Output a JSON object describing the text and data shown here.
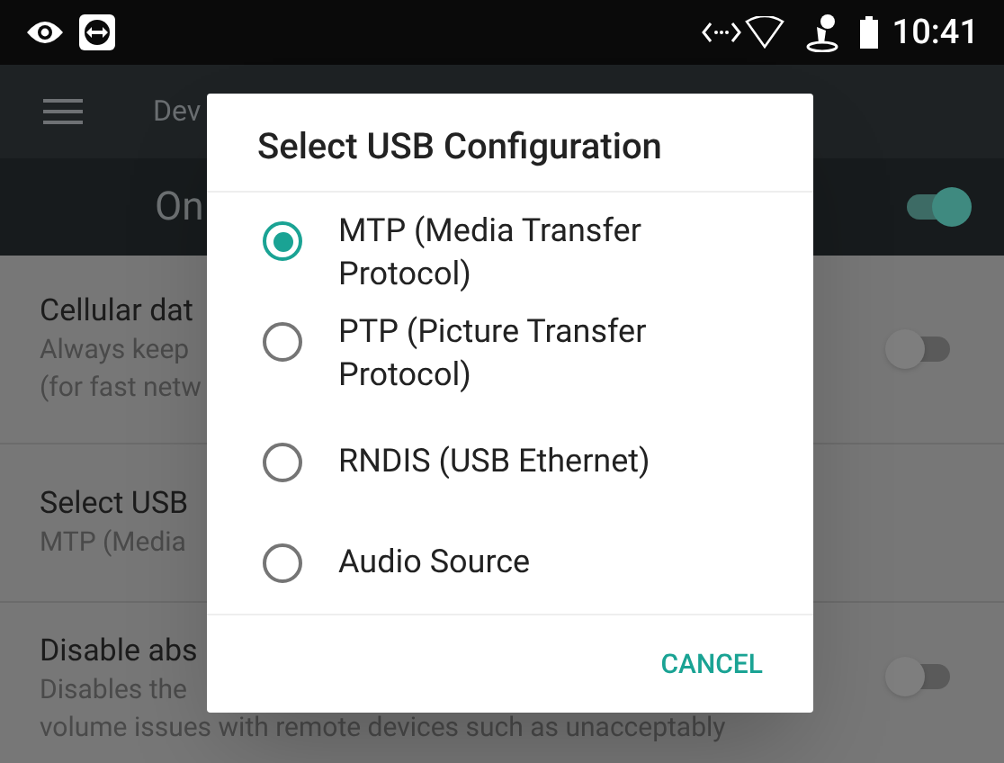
{
  "status_bar": {
    "time": "10:41"
  },
  "toolbar": {
    "title": "Dev"
  },
  "master_switch": {
    "label": "On",
    "on": true
  },
  "settings": [
    {
      "title": "Cellular dat",
      "summary": [
        "Always keep",
        "(for fast netw"
      ],
      "switch_on": false
    },
    {
      "title": "Select USB",
      "summary": [
        "MTP (Media"
      ]
    },
    {
      "title": "Disable abs",
      "summary": [
        "Disables the",
        "volume issues with remote devices such as unacceptably"
      ],
      "switch_on": false
    }
  ],
  "dialog": {
    "title": "Select USB Configuration",
    "options": [
      {
        "label": "MTP (Media Transfer Protocol)",
        "selected": true
      },
      {
        "label": "PTP (Picture Transfer Protocol)",
        "selected": false
      },
      {
        "label": "RNDIS (USB Ethernet)",
        "selected": false
      },
      {
        "label": "Audio Source",
        "selected": false
      }
    ],
    "cancel": "CANCEL"
  }
}
